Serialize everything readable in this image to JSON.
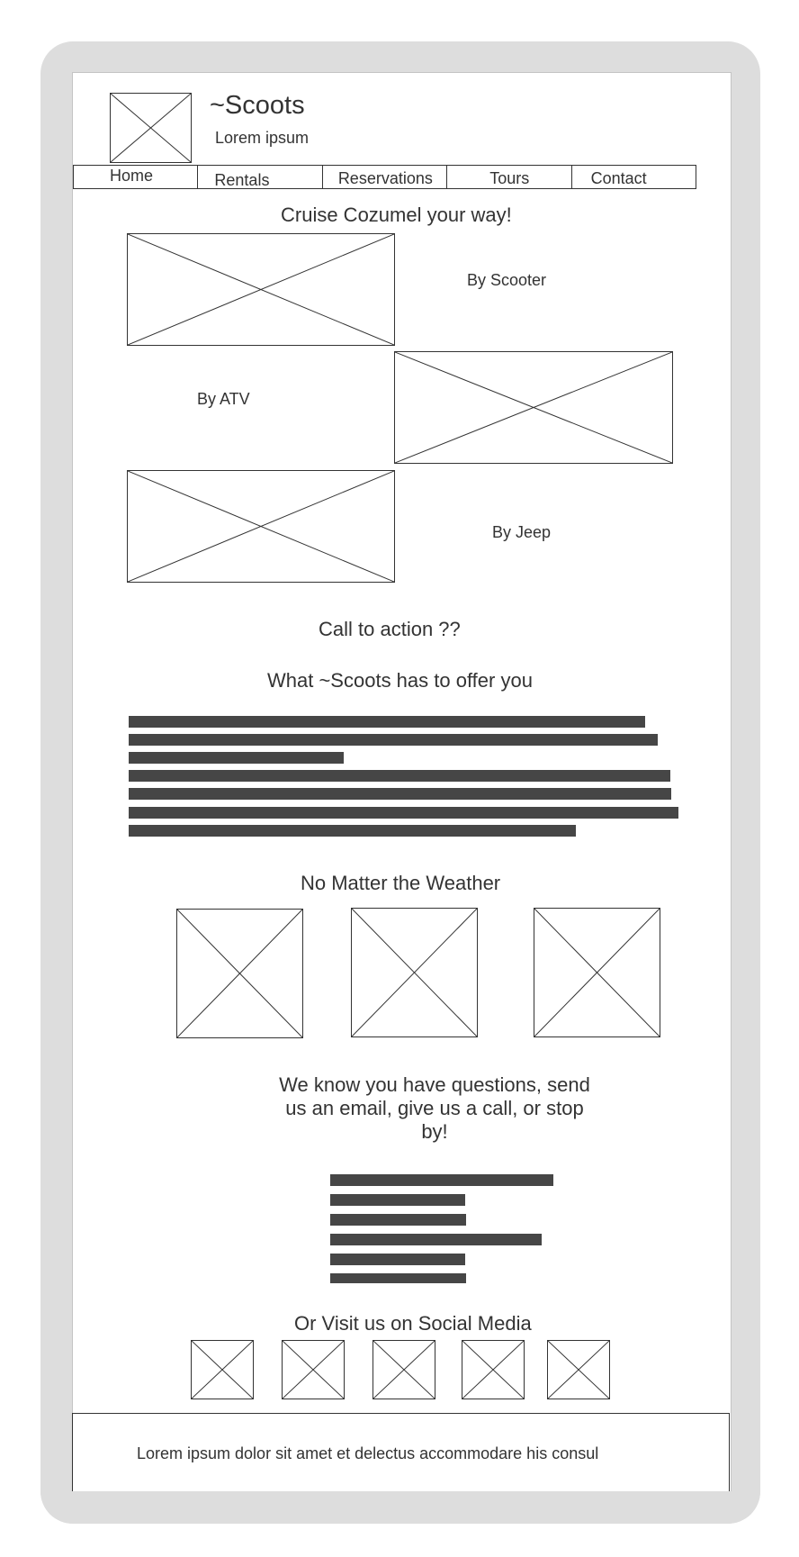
{
  "header": {
    "brand": "~Scoots",
    "tagline": "Lorem ipsum"
  },
  "nav": {
    "items": [
      "Home",
      "Rentals",
      "Reservations",
      "Tours",
      "Contact"
    ]
  },
  "hero": {
    "title": "Cruise Cozumel your way!",
    "options": [
      "By Scooter",
      "By ATV",
      "By Jeep"
    ]
  },
  "cta": {
    "label": "Call to action ??"
  },
  "offer": {
    "title": "What ~Scoots has to offer you"
  },
  "weather": {
    "title": "No Matter the Weather"
  },
  "contact": {
    "lines": [
      "We know you have questions, send",
      "us an email, give us a call, or stop",
      "by!"
    ]
  },
  "social": {
    "title": "Or Visit us on Social Media",
    "icons": [
      "social-icon-1",
      "social-icon-2",
      "social-icon-3",
      "social-icon-4",
      "social-icon-5"
    ]
  },
  "footer": {
    "text": "Lorem ipsum dolor sit amet et delectus accommodare his consul"
  },
  "colors": {
    "frame": "#dddddd",
    "text": "#333333",
    "placeholder_bar": "#464646"
  }
}
